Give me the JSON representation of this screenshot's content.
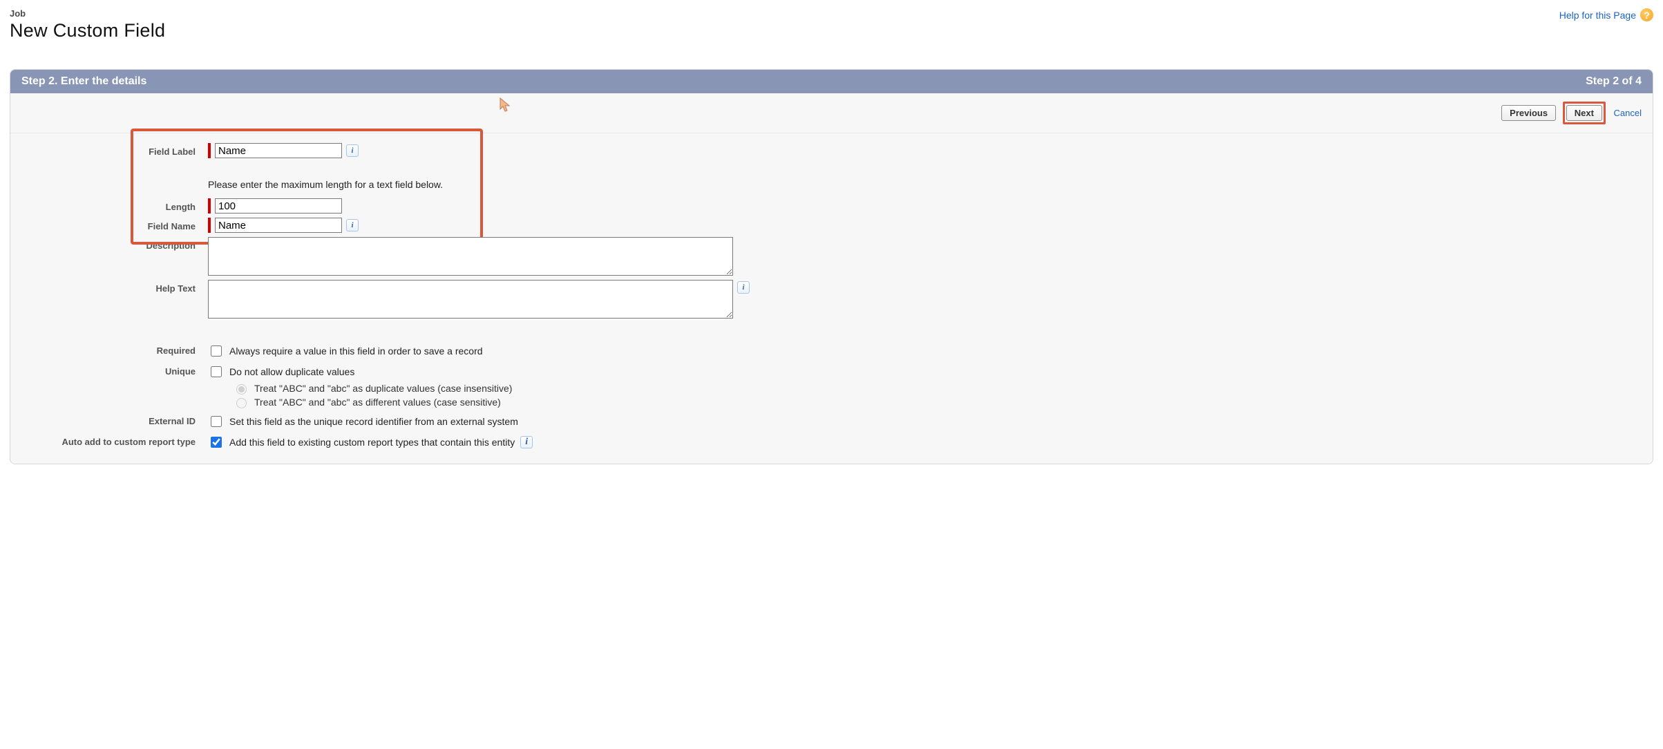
{
  "header": {
    "crumb": "Job",
    "title": "New Custom Field",
    "help_link": "Help for this Page"
  },
  "step": {
    "title": "Step 2. Enter the details",
    "indicator": "Step 2 of 4"
  },
  "buttons": {
    "previous": "Previous",
    "next": "Next",
    "cancel": "Cancel"
  },
  "form": {
    "field_label": {
      "label": "Field Label",
      "value": "Name"
    },
    "length": {
      "label": "Length",
      "value": "100",
      "helper": "Please enter the maximum length for a text field below."
    },
    "field_name": {
      "label": "Field Name",
      "value": "Name"
    },
    "description": {
      "label": "Description",
      "value": ""
    },
    "help_text": {
      "label": "Help Text",
      "value": ""
    },
    "required": {
      "label": "Required",
      "text": "Always require a value in this field in order to save a record",
      "checked": false
    },
    "unique": {
      "label": "Unique",
      "text": "Do not allow duplicate values",
      "checked": false,
      "options": {
        "ci": "Treat \"ABC\" and \"abc\" as duplicate values (case insensitive)",
        "cs": "Treat \"ABC\" and \"abc\" as different values (case sensitive)",
        "selected": "ci"
      }
    },
    "external_id": {
      "label": "External ID",
      "text": "Set this field as the unique record identifier from an external system",
      "checked": false
    },
    "auto_add": {
      "label": "Auto add to custom report type",
      "text": "Add this field to existing custom report types that contain this entity",
      "checked": true
    }
  },
  "icons": {
    "info": "i",
    "help": "?"
  }
}
